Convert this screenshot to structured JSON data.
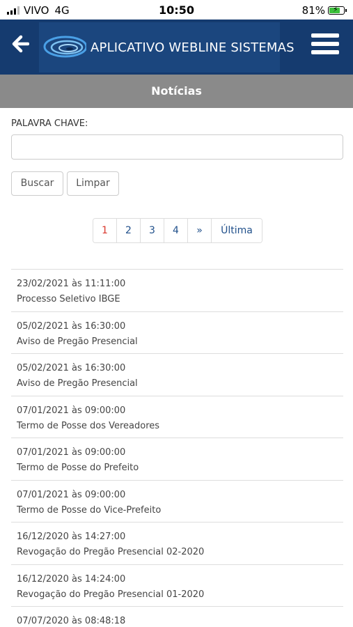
{
  "status_bar": {
    "carrier": "VIVO",
    "network": "4G",
    "time": "10:50",
    "battery": "81%",
    "battery_level": 0.81
  },
  "header": {
    "title": "APLICATIVO WEBLINE SISTEMAS",
    "back_icon": "arrow-left-icon",
    "menu_icon": "hamburger-menu-icon",
    "color": "#153b6f"
  },
  "sub_header": {
    "title": "Notícias",
    "color": "#8a8a8a"
  },
  "search": {
    "label": "PALAVRA CHAVE:",
    "value": "",
    "placeholder": "",
    "search_button": "Buscar",
    "clear_button": "Limpar"
  },
  "pagination": {
    "pages": [
      "1",
      "2",
      "3",
      "4"
    ],
    "active_page": "1",
    "next": "»",
    "last": "Última"
  },
  "news": [
    {
      "date": "23/02/2021 às 11:11:00",
      "title": "Processo Seletivo IBGE"
    },
    {
      "date": "05/02/2021 às 16:30:00",
      "title": "Aviso de Pregão Presencial"
    },
    {
      "date": "05/02/2021 às 16:30:00",
      "title": "Aviso de Pregão Presencial"
    },
    {
      "date": "07/01/2021 às 09:00:00",
      "title": "Termo de Posse dos Vereadores"
    },
    {
      "date": "07/01/2021 às 09:00:00",
      "title": "Termo de Posse do Prefeito"
    },
    {
      "date": "07/01/2021 às 09:00:00",
      "title": "Termo de Posse do Vice-Prefeito"
    },
    {
      "date": "16/12/2020 às 14:27:00",
      "title": "Revogação do Pregão Presencial 02-2020"
    },
    {
      "date": "16/12/2020 às 14:24:00",
      "title": "Revogação do Pregão Presencial 01-2020"
    },
    {
      "date": "07/07/2020 às 08:48:18",
      "title": ""
    }
  ]
}
